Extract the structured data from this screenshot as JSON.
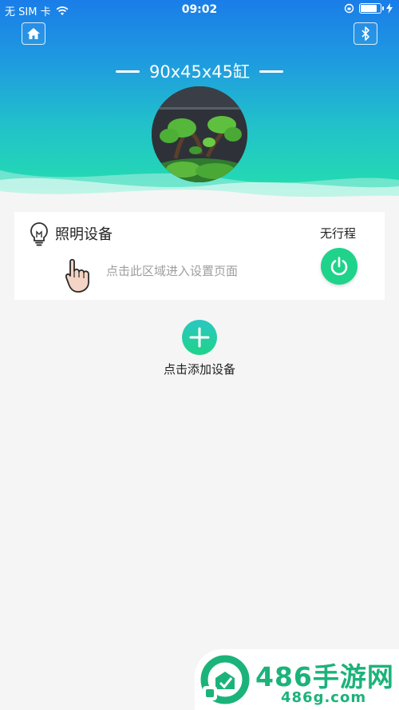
{
  "status_bar": {
    "carrier": "无 SIM 卡",
    "time": "09:02",
    "battery_level": 0.85
  },
  "header": {
    "tank_title": "90x45x45缸",
    "home_icon": "home-icon",
    "bluetooth_icon": "bluetooth-icon"
  },
  "device": {
    "name": "照明设备",
    "status": "无行程",
    "hint": "点击此区域进入设置页面",
    "icon": "lightbulb-icon",
    "power_icon": "power-icon",
    "power_color": "#1fd38a"
  },
  "add_device": {
    "label": "点击添加设备",
    "icon": "plus-icon"
  },
  "watermark": {
    "title": "486手游网",
    "url": "486g.com",
    "color": "#1bb37a"
  },
  "colors": {
    "header_top": "#1a7de8",
    "header_bottom": "#24e3a8",
    "background": "#f5f5f5"
  }
}
